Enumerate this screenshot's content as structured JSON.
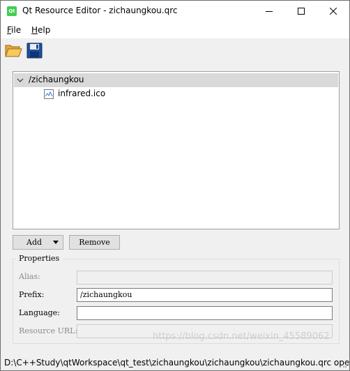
{
  "window": {
    "title": "Qt Resource Editor - zichaungkou.qrc",
    "app_icon_text": "Qt"
  },
  "menu": {
    "file_accel": "F",
    "file_rest": "ile",
    "help_accel": "H",
    "help_rest": "elp"
  },
  "toolbar": {
    "open_icon": "folder-open-icon",
    "save_icon": "floppy-save-icon"
  },
  "tree": {
    "prefix": "/zichaungkou",
    "files": [
      {
        "name": "infrared.ico",
        "icon": "image-file-icon"
      }
    ]
  },
  "buttons": {
    "add": "Add",
    "remove": "Remove"
  },
  "properties": {
    "title": "Properties",
    "alias_label": "Alias:",
    "alias_value": "",
    "prefix_label": "Prefix:",
    "prefix_value": "/zichaungkou",
    "language_label": "Language:",
    "language_value": "",
    "resource_url_label": "Resource URL:",
    "resource_url_value": ""
  },
  "status": {
    "text": "D:\\C++Study\\qtWorkspace\\qt_test\\zichaungkou\\zichaungkou\\zichaungkou.qrc ope"
  },
  "watermark": "https://blog.csdn.net/weixin_45589062",
  "colors": {
    "qt_green": "#41cd52",
    "selection": "#d9d9d9",
    "window_bg": "#f0f0f0"
  }
}
